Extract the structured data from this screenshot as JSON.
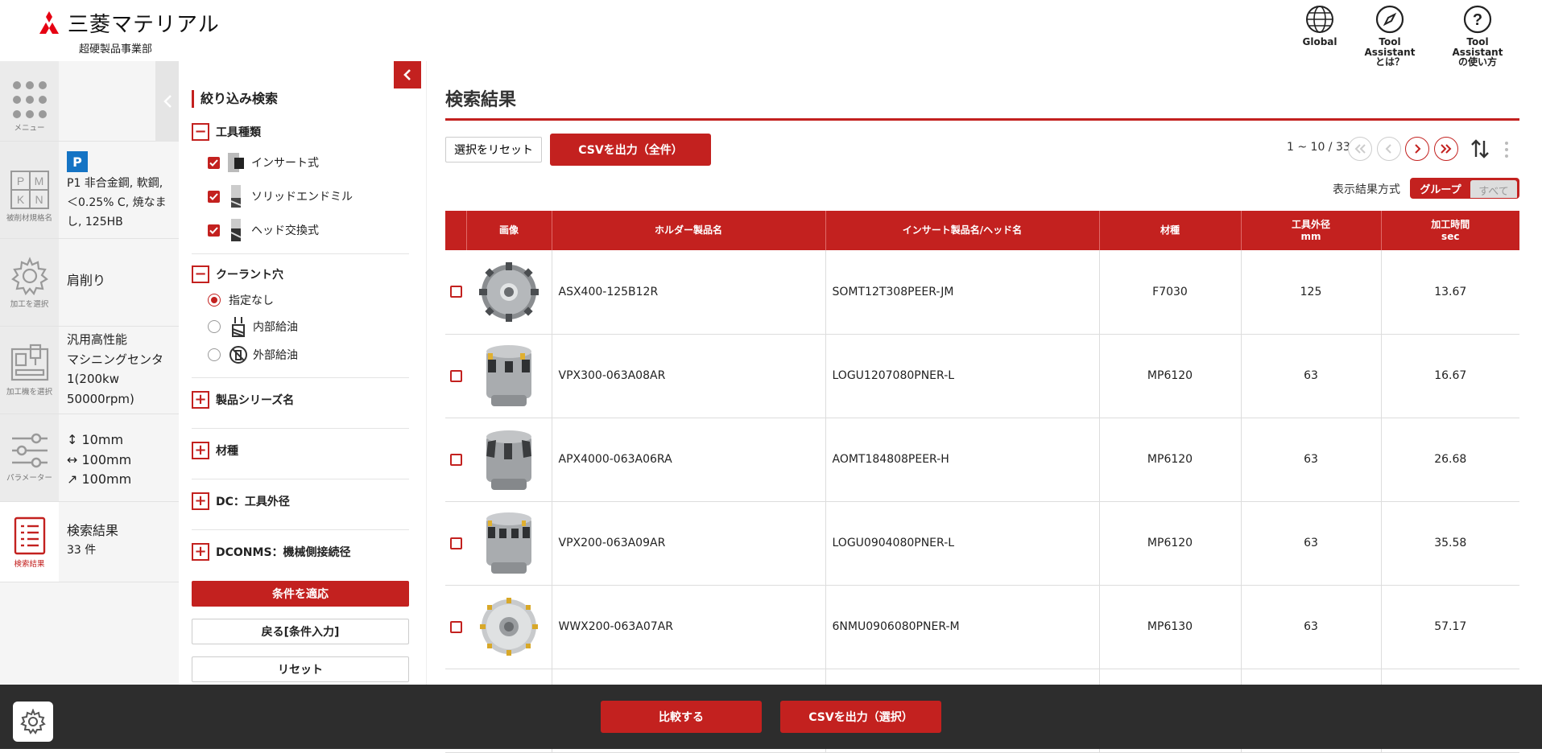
{
  "header": {
    "brand": "三菱マテリアル",
    "division": "超硬製品事業部",
    "global_label": "Global",
    "about_label_1": "Tool Assistant",
    "about_label_2": "とは？",
    "howto_label_1": "Tool Assistant",
    "howto_label_2": "の使い方"
  },
  "nav": {
    "menu_caption": "メニュー",
    "material_caption": "被削材規格名",
    "material_badge": "P",
    "material_text_1": "P1 非合金鋼, 軟鋼,",
    "material_text_2": "＜0.25% C, 焼なま",
    "material_text_3": "し, 125HB",
    "pmkn": [
      "P",
      "M",
      "K",
      "N"
    ],
    "process_caption": "加工を選択",
    "process_text": "肩削り",
    "machine_caption": "加工機を選択",
    "machine_text_1": "汎用高性能",
    "machine_text_2": "マシニングセンタ",
    "machine_text_3": "1(200kw",
    "machine_text_4": "50000rpm)",
    "param_caption": "パラメーター",
    "param_1": "↕ 10mm",
    "param_2": "↔ 100mm",
    "param_3": "↗ 100mm",
    "result_caption": "検索結果",
    "result_text": "検索結果",
    "result_count": "33 件"
  },
  "filter": {
    "title": "絞り込み検索",
    "tool_type": "工具種類",
    "tool_items": [
      "インサート式",
      "ソリッドエンドミル",
      "ヘッド交換式"
    ],
    "coolant": "クーラント穴",
    "coolant_items": [
      "指定なし",
      "内部給油",
      "外部給油"
    ],
    "series": "製品シリーズ名",
    "grade": "材種",
    "dc": "DC：工具外径",
    "dconms": "DCONMS：機械側接続径",
    "apply": "条件を適応",
    "back": "戻る[条件入力]",
    "reset": "リセット"
  },
  "main": {
    "title": "検索結果",
    "reset_selection": "選択をリセット",
    "csv_all": "CSVを出力（全件）",
    "pager_text": "1 ~ 10 / 33",
    "display_mode": "表示結果方式",
    "mode_group": "グループ",
    "mode_all": "すべて",
    "columns": {
      "image": "画像",
      "holder": "ホルダー製品名",
      "insert": "インサート製品名/ヘッド名",
      "grade": "材種",
      "dia_1": "工具外径",
      "dia_2": "mm",
      "time_1": "加工時間",
      "time_2": "sec"
    },
    "rows": [
      {
        "holder": "ASX400-125B12R",
        "insert": "SOMT12T308PEER-JM",
        "grade": "F7030",
        "dia": "125",
        "time": "13.67"
      },
      {
        "holder": "VPX300-063A08AR",
        "insert": "LOGU1207080PNER-L",
        "grade": "MP6120",
        "dia": "63",
        "time": "16.67"
      },
      {
        "holder": "APX4000-063A06RA",
        "insert": "AOMT184808PEER-H",
        "grade": "MP6120",
        "dia": "63",
        "time": "26.68"
      },
      {
        "holder": "VPX200-063A09AR",
        "insert": "LOGU0904080PNER-L",
        "grade": "MP6120",
        "dia": "63",
        "time": "35.58"
      },
      {
        "holder": "WWX200-063A07AR",
        "insert": "6NMU0906080PNER-M",
        "grade": "MP6130",
        "dia": "63",
        "time": "57.17"
      }
    ]
  },
  "footer": {
    "compare": "比較する",
    "csv_selected": "CSVを出力（選択）"
  },
  "colors": {
    "accent": "#c3211f",
    "footer": "#2d2d2d"
  }
}
